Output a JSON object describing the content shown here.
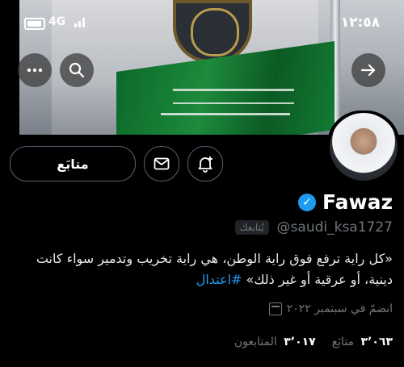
{
  "status_bar": {
    "time": "١٢:٥٨",
    "network": "4G"
  },
  "header": {
    "menu_icon": "more-icon",
    "search_icon": "search-icon",
    "forward_icon": "arrow-right-icon"
  },
  "profile": {
    "display_name": "Fawaz",
    "verified": true,
    "handle": "@saudi_ksa1727",
    "follows_you_label": "يُتابعك",
    "bio_text": "«كل راية ترفع فوق راية الوطن، هي راية تخريب وتدمير سواء كانت دينية، أو عرقية أو غير ذلك» ",
    "bio_hashtag": "#اعتدال",
    "joined": "انضمّ في سبتمبر ٢٠٢٢",
    "following_count": "٣٬٠٦٣",
    "following_label": "متابَع",
    "followers_count": "٣٬٠١٧",
    "followers_label": "المتابعون"
  },
  "actions": {
    "follow_label": "متابَع",
    "message_icon": "mail-icon",
    "notify_icon": "bell-plus-icon"
  },
  "colors": {
    "background": "#000000",
    "accent": "#1d9bf0",
    "muted": "#71767b"
  }
}
